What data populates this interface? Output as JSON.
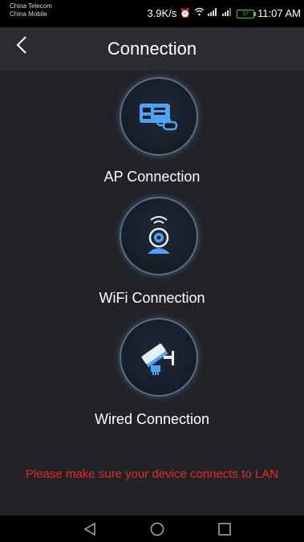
{
  "status_bar": {
    "carrier_1": "China Telecom",
    "carrier_2": "China Mobile",
    "speed": "3.9K/s",
    "battery": "17",
    "time": "11:07 AM"
  },
  "header": {
    "title": "Connection"
  },
  "options": [
    {
      "label": "AP Connection",
      "icon": "router-link-icon"
    },
    {
      "label": "WiFi Connection",
      "icon": "wifi-camera-icon"
    },
    {
      "label": "Wired Connection",
      "icon": "wired-camera-icon"
    }
  ],
  "warning": "Please make sure your device connects to LAN",
  "colors": {
    "background": "#222326",
    "header": "#2b2c30",
    "icon_blue": "#4fa3f7",
    "warning_red": "#e8262a"
  }
}
